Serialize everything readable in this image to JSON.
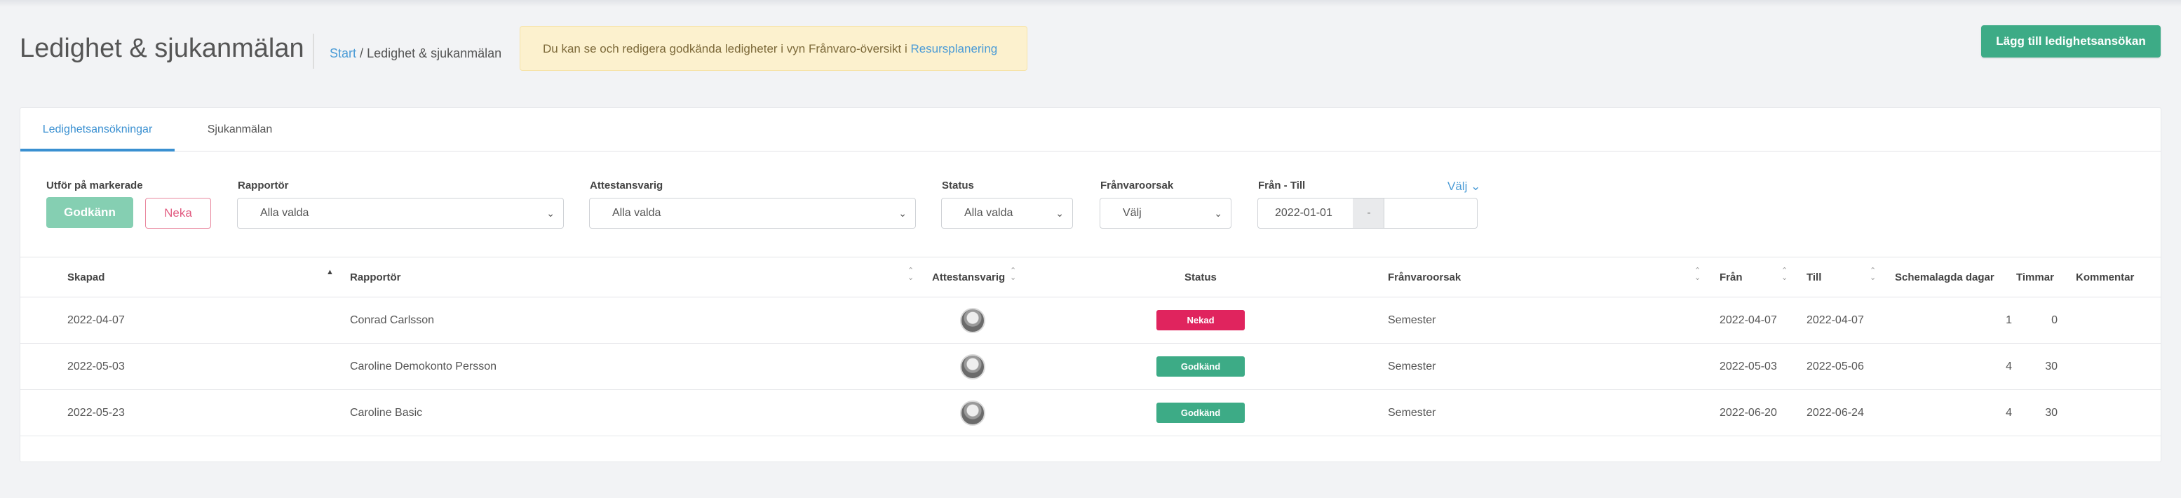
{
  "header": {
    "title": "Ledighet & sjukanmälan",
    "breadcrumb": {
      "start": "Start",
      "separator": "/",
      "current": "Ledighet & sjukanmälan"
    },
    "notice": {
      "text": "Du kan se och redigera godkända ledigheter i vyn Frånvaro-översikt i ",
      "link": "Resursplanering"
    },
    "add_button": "Lägg till ledighetsansökan"
  },
  "tabs": [
    {
      "label": "Ledighetsansökningar",
      "active": true
    },
    {
      "label": "Sjukanmälan",
      "active": false
    }
  ],
  "filters": {
    "bulk_label": "Utför på markerade",
    "approve_label": "Godkänn",
    "deny_label": "Neka",
    "reporter": {
      "label": "Rapportör",
      "value": "Alla valda"
    },
    "attester": {
      "label": "Attestansvarig",
      "value": "Alla valda"
    },
    "status": {
      "label": "Status",
      "value": "Alla valda"
    },
    "reason": {
      "label": "Frånvaroorsak",
      "value": "Välj"
    },
    "date_range": {
      "label": "Från - Till",
      "from": "2022-01-01",
      "separator": "-",
      "to": "",
      "pick_link": "Välj ⌄"
    }
  },
  "table": {
    "columns": [
      "Skapad",
      "Rapportör",
      "Attestansvarig",
      "Status",
      "Frånvaroorsak",
      "Från",
      "Till",
      "Schemalagda dagar",
      "Timmar",
      "Kommentar"
    ],
    "rows": [
      {
        "created": "2022-04-07",
        "reporter": "Conrad Carlsson",
        "status": "Nekad",
        "status_color": "#e0245e",
        "reason": "Semester",
        "from": "2022-04-07",
        "to": "2022-04-07",
        "days": "1",
        "hours": "0",
        "comment": ""
      },
      {
        "created": "2022-05-03",
        "reporter": "Caroline Demokonto Persson",
        "status": "Godkänd",
        "status_color": "#3dab86",
        "reason": "Semester",
        "from": "2022-05-03",
        "to": "2022-05-06",
        "days": "4",
        "hours": "30",
        "comment": ""
      },
      {
        "created": "2022-05-23",
        "reporter": "Caroline Basic",
        "status": "Godkänd",
        "status_color": "#3dab86",
        "reason": "Semester",
        "from": "2022-06-20",
        "to": "2022-06-24",
        "days": "4",
        "hours": "30",
        "comment": ""
      }
    ]
  },
  "colors": {
    "accent": "#3a90d1",
    "primary": "#3dab86",
    "danger": "#e0245e"
  }
}
